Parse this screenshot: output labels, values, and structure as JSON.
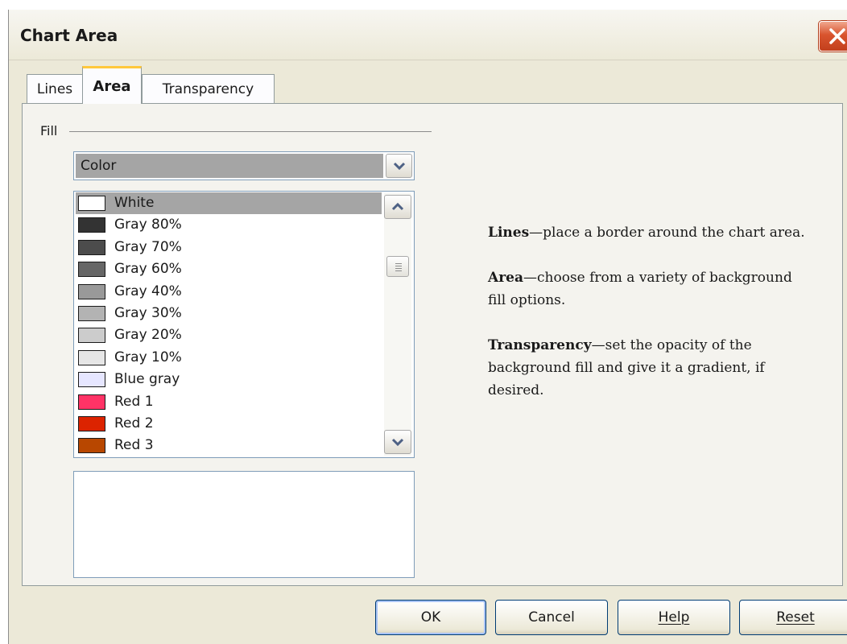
{
  "window": {
    "title": "Chart Area"
  },
  "tabs": [
    {
      "label": "Lines",
      "active": false
    },
    {
      "label": "Area",
      "active": true
    },
    {
      "label": "Transparency",
      "active": false
    }
  ],
  "fill": {
    "group_label": "Fill",
    "type_selected": "Color"
  },
  "color_list": {
    "selected": "White",
    "items": [
      {
        "label": "White",
        "color": "#ffffff"
      },
      {
        "label": "Gray 80%",
        "color": "#333333"
      },
      {
        "label": "Gray 70%",
        "color": "#4c4c4c"
      },
      {
        "label": "Gray 60%",
        "color": "#666666"
      },
      {
        "label": "Gray 40%",
        "color": "#999999"
      },
      {
        "label": "Gray 30%",
        "color": "#b3b3b3"
      },
      {
        "label": "Gray 20%",
        "color": "#cccccc"
      },
      {
        "label": "Gray 10%",
        "color": "#e6e6e6"
      },
      {
        "label": "Blue gray",
        "color": "#e6e6ff"
      },
      {
        "label": "Red 1",
        "color": "#ff3366"
      },
      {
        "label": "Red 2",
        "color": "#dc2300"
      },
      {
        "label": "Red 3",
        "color": "#b84700"
      }
    ]
  },
  "help": [
    {
      "term": "Lines",
      "text": "—place a border around the chart area."
    },
    {
      "term": "Area",
      "text": "—choose from a variety of background fill options."
    },
    {
      "term": "Transparency",
      "text": "—set the opacity of the background fill and give it a gradient, if desired."
    }
  ],
  "buttons": {
    "ok": "OK",
    "cancel": "Cancel",
    "help": "Help",
    "reset": "Reset"
  },
  "icons": {
    "close": "close-icon",
    "dropdown": "chevron-down-icon",
    "scroll_up": "chevron-up-icon",
    "scroll_down": "chevron-down-icon"
  }
}
